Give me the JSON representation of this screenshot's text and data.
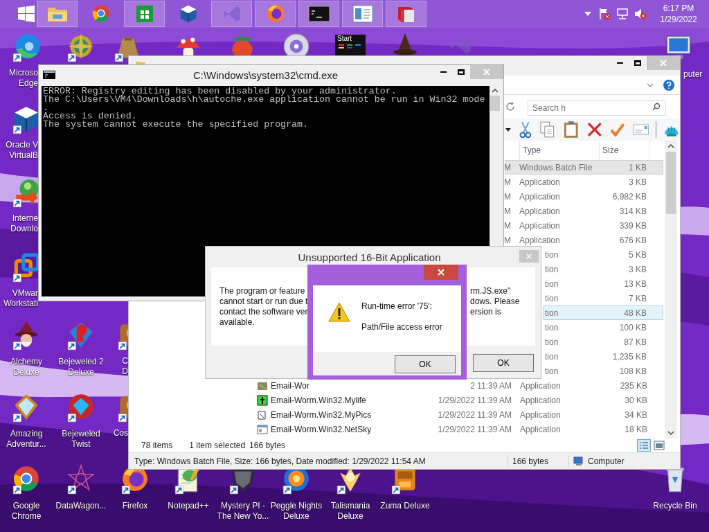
{
  "taskbar": {
    "buttons": [
      {
        "running": true
      },
      {
        "running": false
      },
      {
        "running": true
      },
      {
        "running": false
      },
      {
        "running": true
      },
      {
        "running": true
      },
      {
        "running": true
      },
      {
        "running": true
      },
      {
        "running": true
      }
    ],
    "clock": {
      "time": "6:17 PM",
      "date": "1/29/2022"
    }
  },
  "start_tile": {
    "label": "Start"
  },
  "desktop_icons": [
    {
      "lines": [
        "Microso",
        "Edge"
      ]
    },
    {
      "lines": [
        "Oracle V",
        "VirtualB"
      ]
    },
    {
      "lines": [
        "Interne",
        "Downlo"
      ]
    },
    {
      "lines": [
        "VMwar",
        "Workstati"
      ]
    },
    {
      "lines": [
        "Alchemy",
        "Deluxe"
      ]
    },
    {
      "lines": [
        "Amazing",
        "Adventur..."
      ]
    },
    {
      "lines": [
        "Bejeweled 2",
        "Deluxe"
      ]
    },
    {
      "lines": [
        "Bejeweled",
        "Twist"
      ]
    },
    {
      "lines": [
        "C",
        "D"
      ]
    },
    {
      "lines": [
        "Cos"
      ]
    },
    {
      "lines": [
        "Google",
        "Chrome"
      ]
    },
    {
      "lines": [
        "DataWagon..."
      ]
    },
    {
      "lines": [
        "Firefox"
      ]
    },
    {
      "lines": [
        "Notepad++"
      ]
    },
    {
      "lines": [
        "Mystery PI -",
        "The New Yo..."
      ]
    },
    {
      "lines": [
        "Peggle Nights",
        "Deluxe"
      ]
    },
    {
      "lines": [
        "Talismania",
        "Deluxe"
      ]
    },
    {
      "lines": [
        "Zuma Deluxe"
      ]
    },
    {
      "lines": [
        "Recycle Bin"
      ]
    },
    {
      "lines": [
        "puter"
      ]
    }
  ],
  "explorer": {
    "search": {
      "placeholder": "Search h"
    },
    "columns": [
      "Type",
      "Size"
    ],
    "rows": [
      {
        "date": "M",
        "type": "Windows Batch File",
        "size": "1 KB",
        "selected": true,
        "hovered": false
      },
      {
        "date": "M",
        "type": "Application",
        "size": "3 KB",
        "selected": false,
        "hovered": false
      },
      {
        "date": "M",
        "type": "Application",
        "size": "6,982 KB",
        "selected": false,
        "hovered": false
      },
      {
        "date": "M",
        "type": "Application",
        "size": "314 KB",
        "selected": false,
        "hovered": false
      },
      {
        "date": "M",
        "type": "Application",
        "size": "339 KB",
        "selected": false,
        "hovered": false
      },
      {
        "date": "M",
        "type": "Application",
        "size": "676 KB",
        "selected": false,
        "hovered": false
      },
      {
        "type": "tion",
        "size": "5 KB",
        "selected": false,
        "hovered": false
      },
      {
        "type": "tion",
        "size": "3 KB",
        "selected": false,
        "hovered": false
      },
      {
        "type": "tion",
        "size": "13 KB",
        "selected": false,
        "hovered": false
      },
      {
        "type": "tion",
        "size": "7 KB",
        "selected": false,
        "hovered": false
      },
      {
        "type": "tion",
        "size": "48 KB",
        "selected": false,
        "hovered": true
      },
      {
        "type": "tion",
        "size": "100 KB",
        "selected": false,
        "hovered": false
      },
      {
        "type": "tion",
        "size": "87 KB",
        "selected": false,
        "hovered": false
      },
      {
        "type": "tion",
        "size": "1,235 KB",
        "selected": false,
        "hovered": false
      },
      {
        "type": "tion",
        "size": "108 KB",
        "selected": false,
        "hovered": false
      },
      {
        "name": "Email-Wor",
        "date": "2 11:39 AM",
        "type": "Application",
        "size": "235 KB",
        "selected": false,
        "hovered": false
      },
      {
        "name": "Email-Worm.Win32.Mylife",
        "date": "1/29/2022 11:39 AM",
        "type": "Application",
        "size": "30 KB",
        "selected": false,
        "hovered": false
      },
      {
        "name": "Email-Worm.Win32.MyPics",
        "date": "1/29/2022 11:39 AM",
        "type": "Application",
        "size": "34 KB",
        "selected": false,
        "hovered": false
      },
      {
        "name": "Email-Worm.Win32.NetSky",
        "date": "1/29/2022 11:39 AM",
        "type": "Application",
        "size": "18 KB",
        "selected": false,
        "hovered": false
      }
    ],
    "status": {
      "count": "78 items",
      "selection": "1 item selected",
      "selection_size": "166 bytes"
    },
    "details_bar": {
      "info": "Type: Windows Batch File, Size: 166 bytes, Date modified: 1/29/2022 11:54 AM",
      "size": "166 bytes",
      "location": "Computer"
    }
  },
  "cmd_window": {
    "title": "C:\\Windows\\system32\\cmd.exe",
    "lines": [
      "ERROR: Registry editing has been disabled by your administrator.",
      "The C:\\Users\\VM4\\Downloads\\h\\autoche.exe application cannot be run in Win32 mode",
      ".",
      "Access is denied.",
      "The system cannot execute the specified program."
    ]
  },
  "dialog_16bit": {
    "title": "Unsupported 16-Bit Application",
    "left_lines": [
      "The program or feature",
      "cannot start or run due t",
      "contact the software ver",
      "available."
    ],
    "right_lines": [
      "rm.JS.exe\"",
      "dows. Please",
      "ersion is"
    ],
    "button": "OK"
  },
  "dialog_runtime": {
    "lines": [
      "Run-time error '75':",
      "Path/File access error"
    ],
    "button": "OK"
  }
}
